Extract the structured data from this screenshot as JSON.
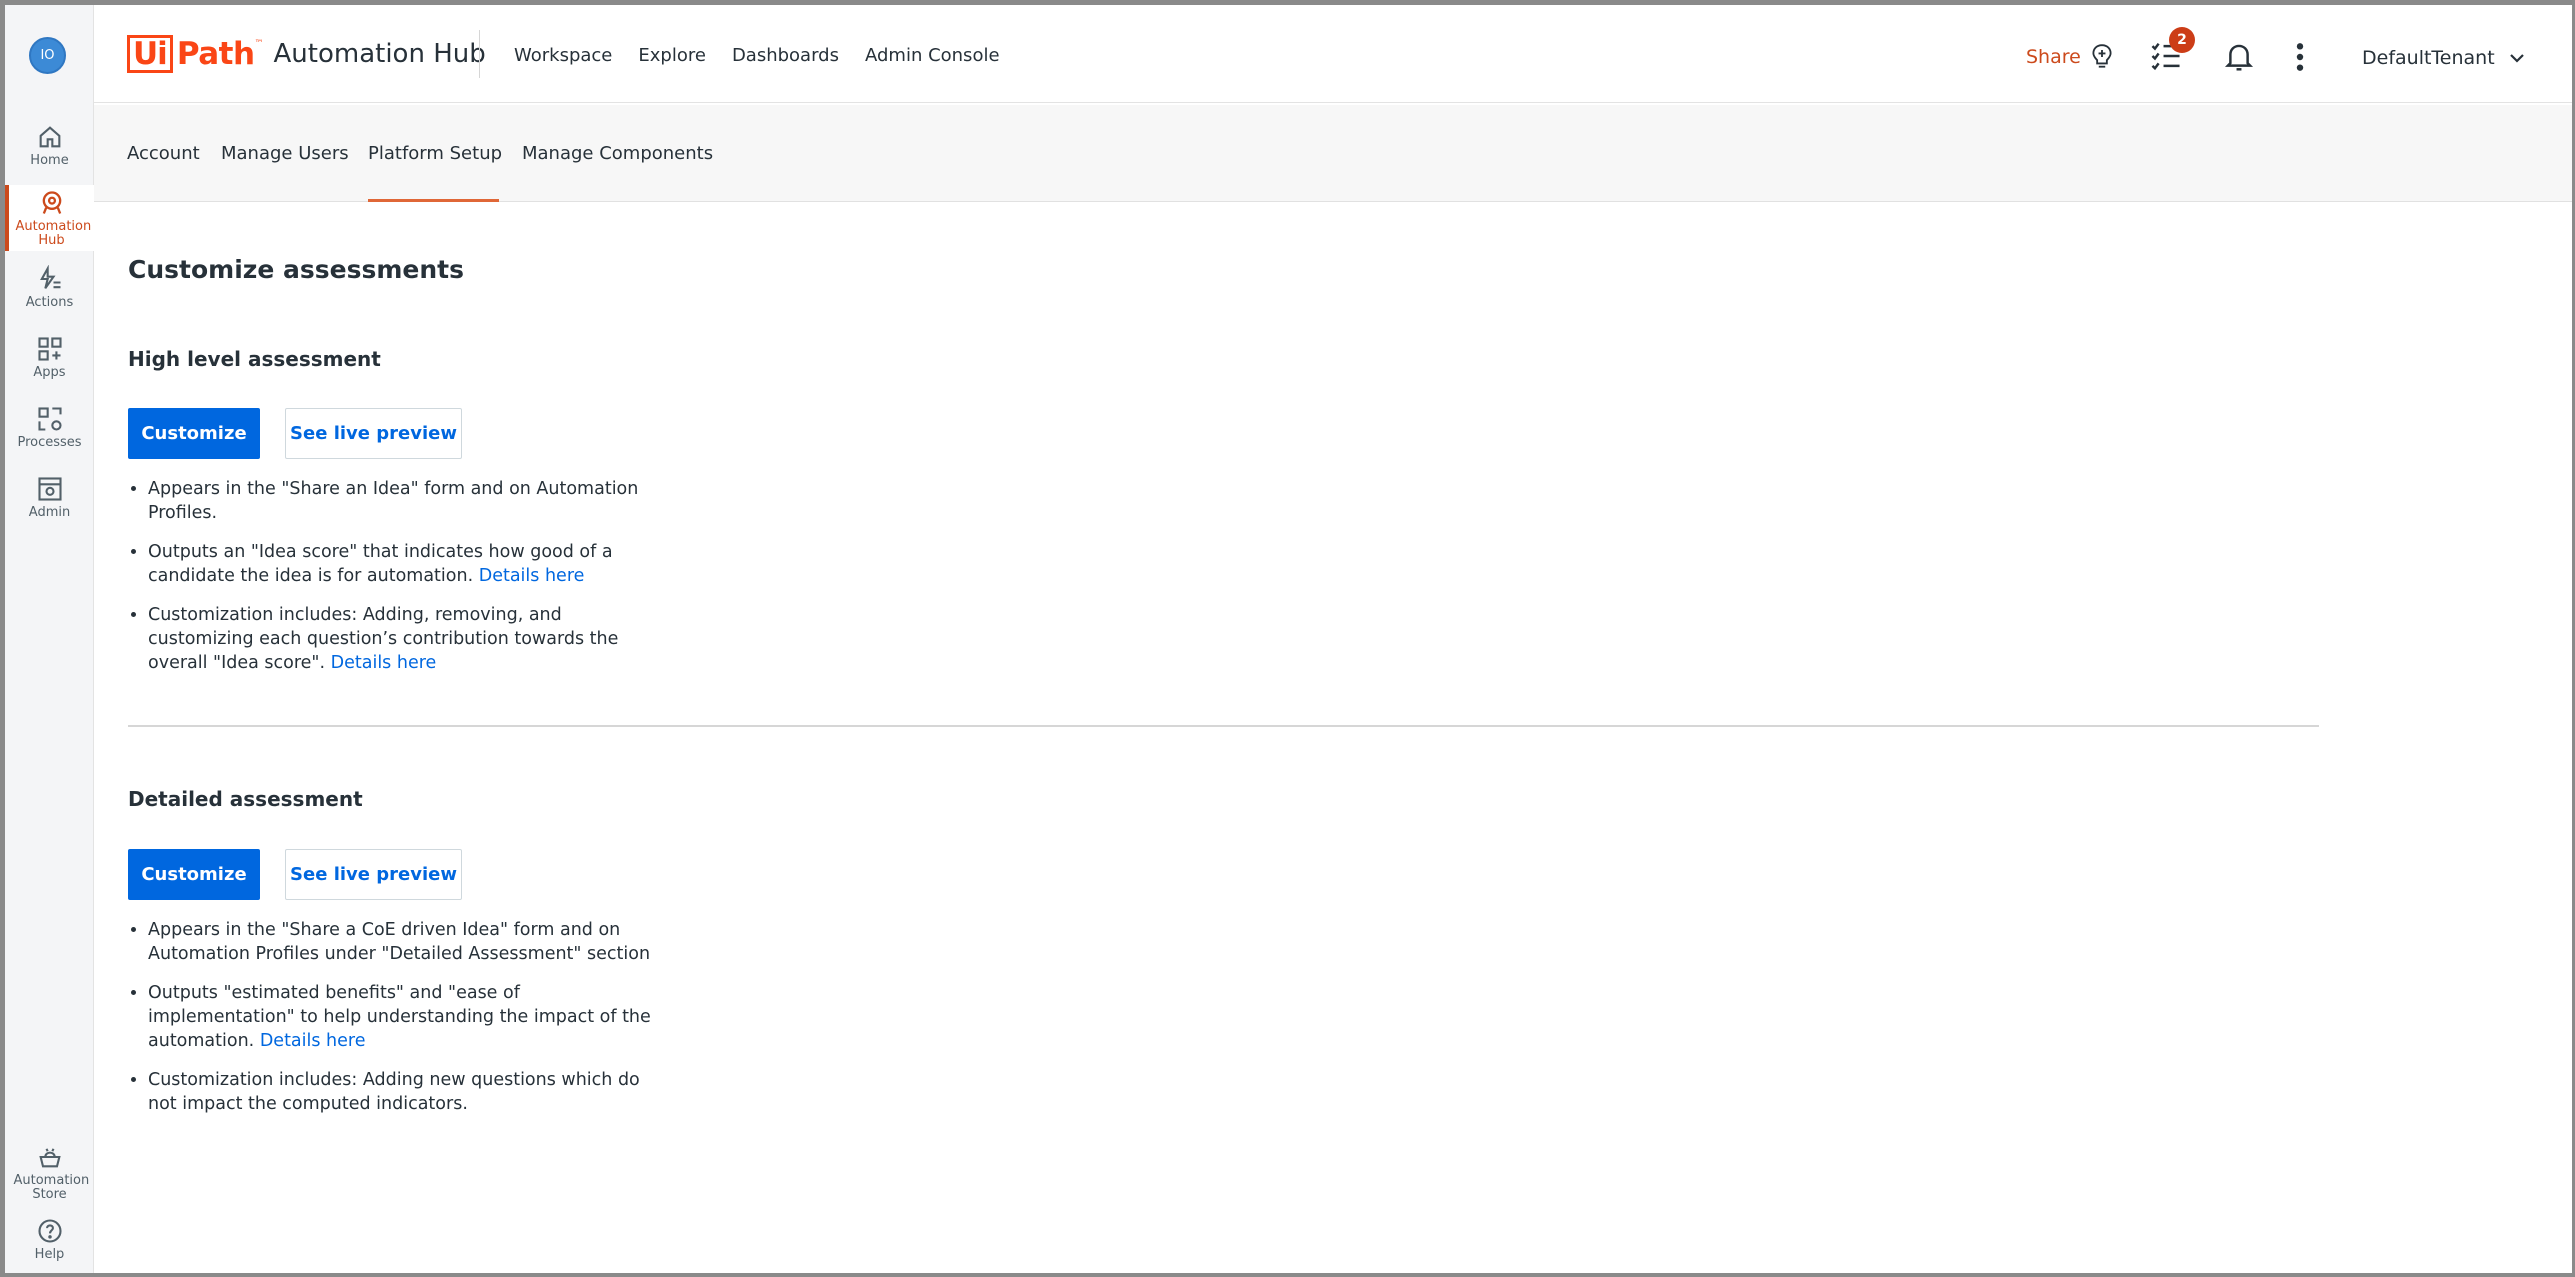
{
  "user": {
    "initials": "IO"
  },
  "rail": {
    "items": [
      {
        "label": "Home",
        "icon": "home-icon"
      },
      {
        "label": "Automation Hub",
        "icon": "automation-hub-icon",
        "active": true
      },
      {
        "label": "Actions",
        "icon": "actions-icon"
      },
      {
        "label": "Apps",
        "icon": "apps-icon"
      },
      {
        "label": "Processes",
        "icon": "processes-icon"
      },
      {
        "label": "Admin",
        "icon": "admin-icon"
      }
    ],
    "bottom_items": [
      {
        "label": "Automation Store",
        "icon": "automation-store-icon"
      },
      {
        "label": "Help",
        "icon": "help-icon"
      }
    ]
  },
  "header": {
    "logo_ui": "Ui",
    "logo_path": "Path",
    "logo_tm": "™",
    "product": "Automation Hub",
    "nav": [
      "Workspace",
      "Explore",
      "Dashboards",
      "Admin Console"
    ],
    "share_label": "Share",
    "task_count": "2",
    "tenant": "DefaultTenant"
  },
  "subnav": {
    "tabs": [
      "Account",
      "Manage Users",
      "Platform Setup",
      "Manage Components"
    ],
    "active_tab": "Platform Setup"
  },
  "main": {
    "title": "Customize assessments",
    "high_level": {
      "title": "High level assessment",
      "customize_label": "Customize",
      "preview_label": "See live preview",
      "bullet1": "Appears in the \"Share an Idea\" form and on Automation Profiles.",
      "bullet2": "Outputs an \"Idea score\" that indicates how good of a candidate the idea is for automation.",
      "bullet2_link": "Details here",
      "bullet3": "Customization includes: Adding, removing, and customizing each question’s contribution towards the overall \"Idea score\".",
      "bullet3_link": "Details here"
    },
    "detailed": {
      "title": "Detailed assessment",
      "customize_label": "Customize",
      "preview_label": "See live preview",
      "bullet1": "Appears in the \"Share a CoE driven Idea\" form and on Automation Profiles under \"Detailed Assessment\" section",
      "bullet2": "Outputs \"estimated benefits\" and \"ease of implementation\" to help understanding the impact of the automation.",
      "bullet2_link": "Details here",
      "bullet3": "Customization includes: Adding new questions which do not impact the computed indicators."
    }
  },
  "colors": {
    "brand_orange": "#fa4616",
    "active_orange": "#cc4a1c",
    "primary_blue": "#0067df"
  }
}
